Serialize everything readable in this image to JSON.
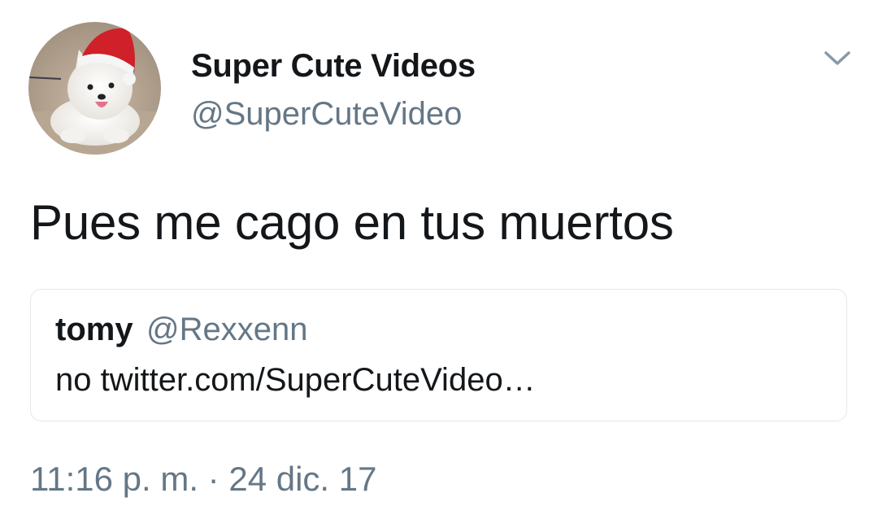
{
  "author": {
    "display_name": "Super Cute Videos",
    "handle": "@SuperCuteVideo",
    "avatar_icon": "samoyed-puppy-santa-hat-avatar"
  },
  "tweet": {
    "text": "Pues me cago en tus muertos",
    "timestamp": "11:16 p. m. · 24 dic. 17"
  },
  "quoted_tweet": {
    "display_name": "tomy",
    "handle": "@Rexxenn",
    "text": "no twitter.com/SuperCuteVideo…"
  },
  "menu": {
    "icon": "chevron-down-icon"
  },
  "colors": {
    "text": "#14171a",
    "secondary_text": "#657786",
    "border": "#e1e8ed"
  }
}
